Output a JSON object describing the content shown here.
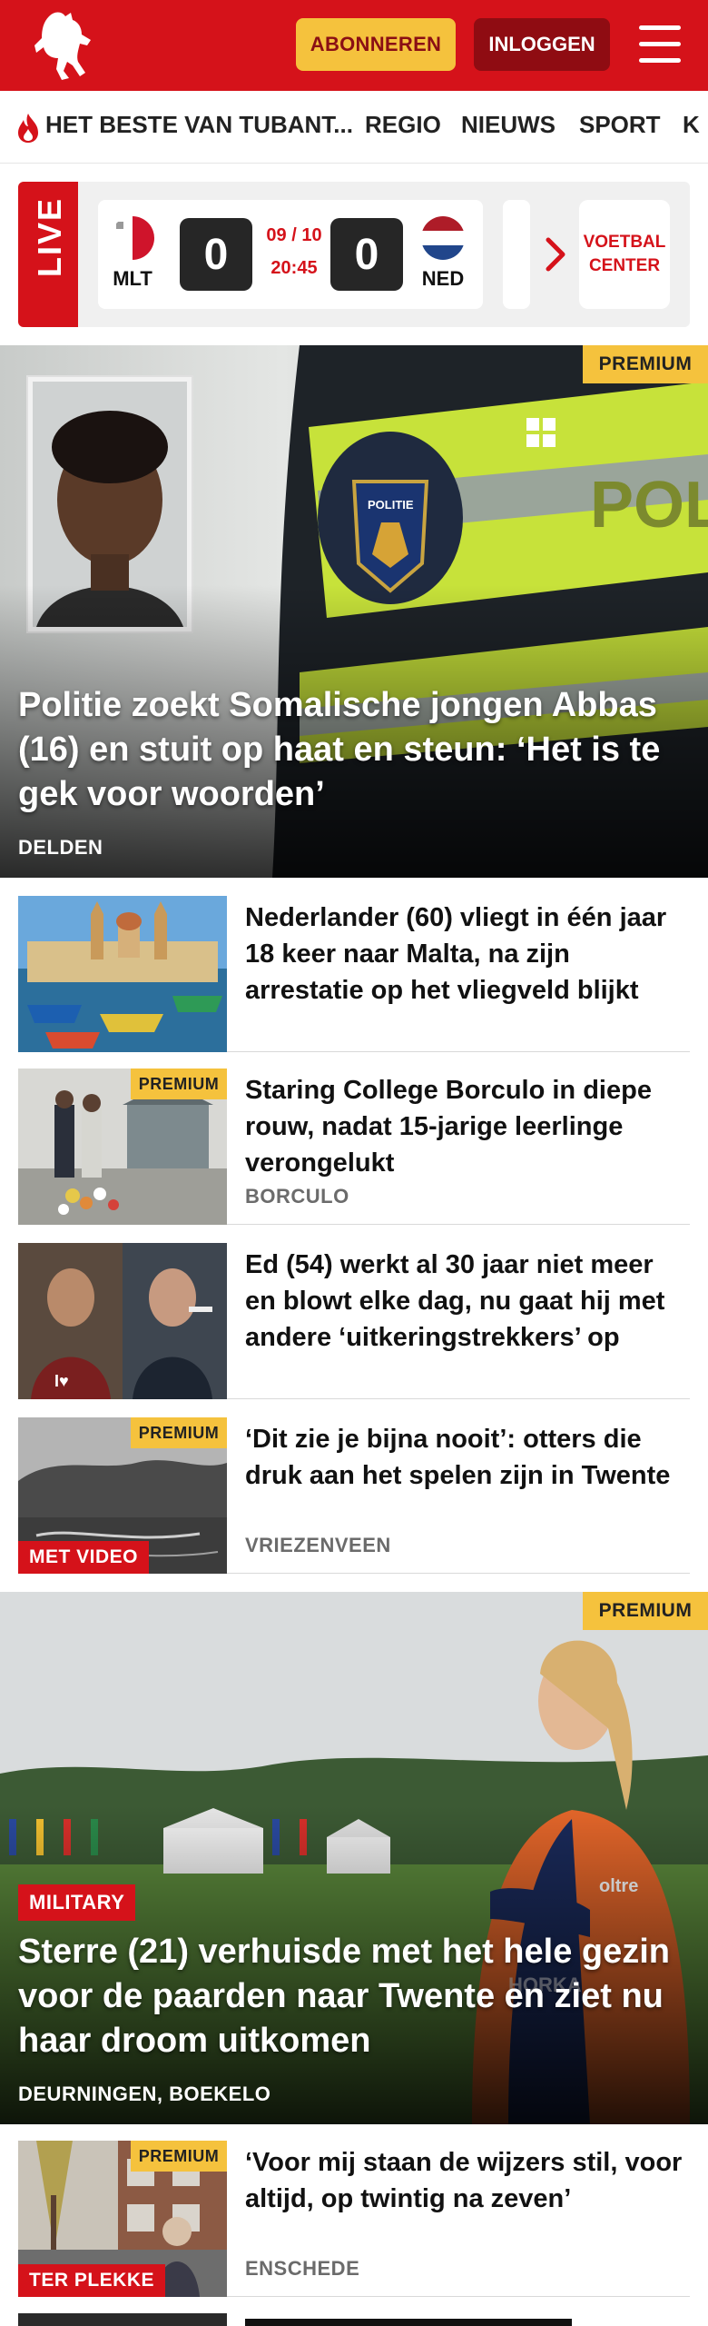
{
  "header": {
    "subscribe_label": "ABONNEREN",
    "login_label": "INLOGGEN",
    "brand_color": "#d5121a",
    "accent_color": "#f5c23d"
  },
  "nav": {
    "items": [
      "HET BESTE VAN TUBANT...",
      "REGIO",
      "NIEUWS",
      "SPORT",
      "K"
    ]
  },
  "live": {
    "label": "LIVE",
    "home_code": "MLT",
    "away_code": "NED",
    "home_score": "0",
    "away_score": "0",
    "date": "09 / 10",
    "time": "20:45",
    "center_label_1": "VOETBAL",
    "center_label_2": "CENTER"
  },
  "hero": {
    "badge": "PREMIUM",
    "title": "Politie zoekt Somalische jongen Abbas (16) en stuit op haat en steun: ‘Het is te gek voor woorden’",
    "location": "DELDEN",
    "vest_text": "POLITIE"
  },
  "articles": [
    {
      "title": "Nederlander (60) vliegt in één jaar 18 keer naar Malta, na zijn arrestatie op het vliegveld blijkt",
      "location": "",
      "badge": "",
      "tag": ""
    },
    {
      "title": "Staring College Borculo in diepe rouw, nadat 15-jarige leerlinge verongelukt",
      "location": "BORCULO",
      "badge": "PREMIUM",
      "tag": ""
    },
    {
      "title": "Ed (54) werkt al 30 jaar niet meer en blowt elke dag, nu gaat hij met andere ‘uitkeringstrekkers’ op",
      "location": "",
      "badge": "",
      "tag": ""
    },
    {
      "title": "‘Dit zie je bijna nooit’: otters die druk aan het spelen zijn in Twente",
      "location": "VRIEZENVEEN",
      "badge": "PREMIUM",
      "tag": "MET VIDEO"
    }
  ],
  "hero2": {
    "badge": "PREMIUM",
    "tag": "MILITARY",
    "title": "Sterre (21) verhuisde met het hele gezin voor de paarden naar Twente en ziet nu haar droom uitkomen",
    "location": "DEURNINGEN, BOEKELO",
    "jacket_text": "HORKA"
  },
  "article_last": {
    "title": "‘Voor mij staan de wijzers stil, voor altijd, op twintig na zeven’",
    "location": "ENSCHEDE",
    "badge": "PREMIUM",
    "tag": "TER PLEKKE"
  }
}
